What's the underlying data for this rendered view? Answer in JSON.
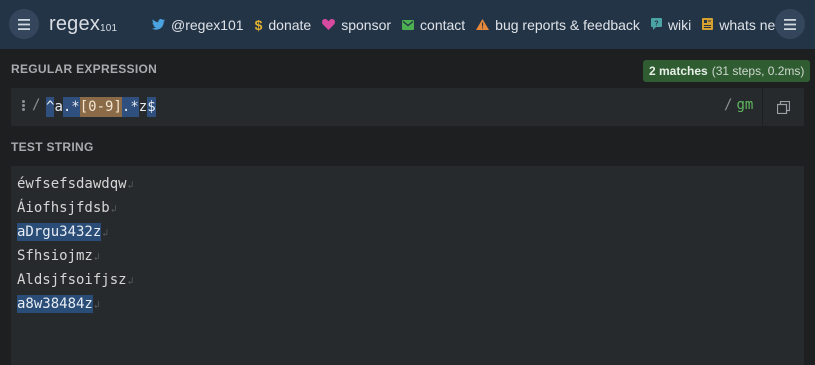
{
  "app": {
    "logo_main": "regex",
    "logo_sub": "101"
  },
  "nav": [
    {
      "icon": "twitter-icon",
      "label": "@regex101",
      "color": "#4aa3df"
    },
    {
      "icon": "dollar-icon",
      "label": "donate",
      "color": "#e0b030"
    },
    {
      "icon": "heart-icon",
      "label": "sponsor",
      "color": "#d64aa0"
    },
    {
      "icon": "mail-icon",
      "label": "contact",
      "color": "#4caf50"
    },
    {
      "icon": "warning-icon",
      "label": "bug reports & feedback",
      "color": "#e8893a"
    },
    {
      "icon": "wiki-icon",
      "label": "wiki",
      "color": "#4ba3a3"
    },
    {
      "icon": "whats-new-icon",
      "label": "whats new?",
      "color": "#d6a030"
    }
  ],
  "regex_section": {
    "label": "REGULAR EXPRESSION",
    "match_count": "2 matches",
    "match_detail": "(31 steps, 0.2ms)",
    "open_delimiter": "/",
    "tokens": [
      "^",
      "a",
      ".*",
      "[0-9]",
      ".*",
      "z",
      "$"
    ],
    "close_delimiter": "/",
    "flags": "gm"
  },
  "test_section": {
    "label": "TEST STRING",
    "lines": [
      {
        "text": "éwfsefsdawdqw",
        "matched": false
      },
      {
        "text": "Áiofhsjfdsb",
        "matched": false
      },
      {
        "text": "aDrgu3432z",
        "matched": true
      },
      {
        "text": "Sfhsiojmz",
        "matched": false
      },
      {
        "text": "Aldsjfsoifjsz",
        "matched": false
      },
      {
        "text": "a8w38484z",
        "matched": true
      }
    ],
    "newline_glyph": "↲"
  },
  "colors": {
    "topbar": "#243447",
    "match_highlight": "#2a4d78",
    "char_class": "#8a6a47",
    "badge": "#2f5c31",
    "flags": "#5fb85f"
  }
}
